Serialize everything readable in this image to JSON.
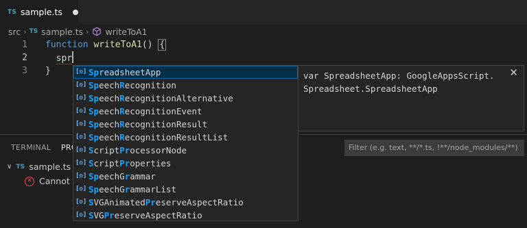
{
  "tab": {
    "badge": "TS",
    "label": "sample.ts"
  },
  "breadcrumb": {
    "folder": "src",
    "file_badge": "TS",
    "file": "sample.ts",
    "symbol": "writeToA1"
  },
  "editor": {
    "lines": [
      {
        "number": "1",
        "keyword": "function",
        "name": "writeToA1",
        "rest": "() ",
        "brace": "{"
      },
      {
        "number": "2",
        "typed": "spr"
      },
      {
        "number": "3",
        "text": "}"
      }
    ]
  },
  "panel": {
    "tabs": [
      "TERMINAL",
      "PROBLEMS"
    ],
    "filter_placeholder": "Filter (e.g. text, **/*.ts, !**/node_modules/**)",
    "problem_file_badge": "TS",
    "problem_file": "sample.ts",
    "problem_text": "Cannot find name 'spr'."
  },
  "suggest": {
    "icon": "[◎]",
    "items": [
      {
        "parts": [
          [
            "Sp",
            true
          ],
          [
            "readsheetApp",
            false
          ]
        ]
      },
      {
        "parts": [
          [
            "Sp",
            true
          ],
          [
            "eech",
            false
          ],
          [
            "R",
            true
          ],
          [
            "ecognition",
            false
          ]
        ]
      },
      {
        "parts": [
          [
            "Sp",
            true
          ],
          [
            "eech",
            false
          ],
          [
            "R",
            true
          ],
          [
            "ecognitionAlternative",
            false
          ]
        ]
      },
      {
        "parts": [
          [
            "Sp",
            true
          ],
          [
            "eech",
            false
          ],
          [
            "R",
            true
          ],
          [
            "ecognitionEvent",
            false
          ]
        ]
      },
      {
        "parts": [
          [
            "Sp",
            true
          ],
          [
            "eech",
            false
          ],
          [
            "R",
            true
          ],
          [
            "ecognitionResult",
            false
          ]
        ]
      },
      {
        "parts": [
          [
            "Sp",
            true
          ],
          [
            "eech",
            false
          ],
          [
            "R",
            true
          ],
          [
            "ecognitionResultList",
            false
          ]
        ]
      },
      {
        "parts": [
          [
            "S",
            true
          ],
          [
            "cript",
            false
          ],
          [
            "Pr",
            true
          ],
          [
            "ocessorNode",
            false
          ]
        ]
      },
      {
        "parts": [
          [
            "S",
            true
          ],
          [
            "cript",
            false
          ],
          [
            "Pr",
            true
          ],
          [
            "operties",
            false
          ]
        ]
      },
      {
        "parts": [
          [
            "Sp",
            true
          ],
          [
            "eechG",
            false
          ],
          [
            "r",
            true
          ],
          [
            "ammar",
            false
          ]
        ]
      },
      {
        "parts": [
          [
            "Sp",
            true
          ],
          [
            "eechG",
            false
          ],
          [
            "r",
            true
          ],
          [
            "ammarList",
            false
          ]
        ]
      },
      {
        "parts": [
          [
            "S",
            true
          ],
          [
            "VGAnimated",
            false
          ],
          [
            "Pr",
            true
          ],
          [
            "eserveAspectRatio",
            false
          ]
        ]
      },
      {
        "parts": [
          [
            "S",
            true
          ],
          [
            "VG",
            false
          ],
          [
            "Pr",
            true
          ],
          [
            "eserveAspectRatio",
            false
          ]
        ]
      }
    ]
  },
  "details": {
    "line1": "var SpreadsheetApp: GoogleAppsScript.",
    "line2": "Spreadsheet.SpreadsheetApp",
    "close": "✕"
  },
  "colors": {
    "accent": "#0e639c",
    "match_highlight": "#18a3ff",
    "keyword": "#569cd6",
    "function": "#dcdcaa",
    "error": "#f14c4c"
  }
}
